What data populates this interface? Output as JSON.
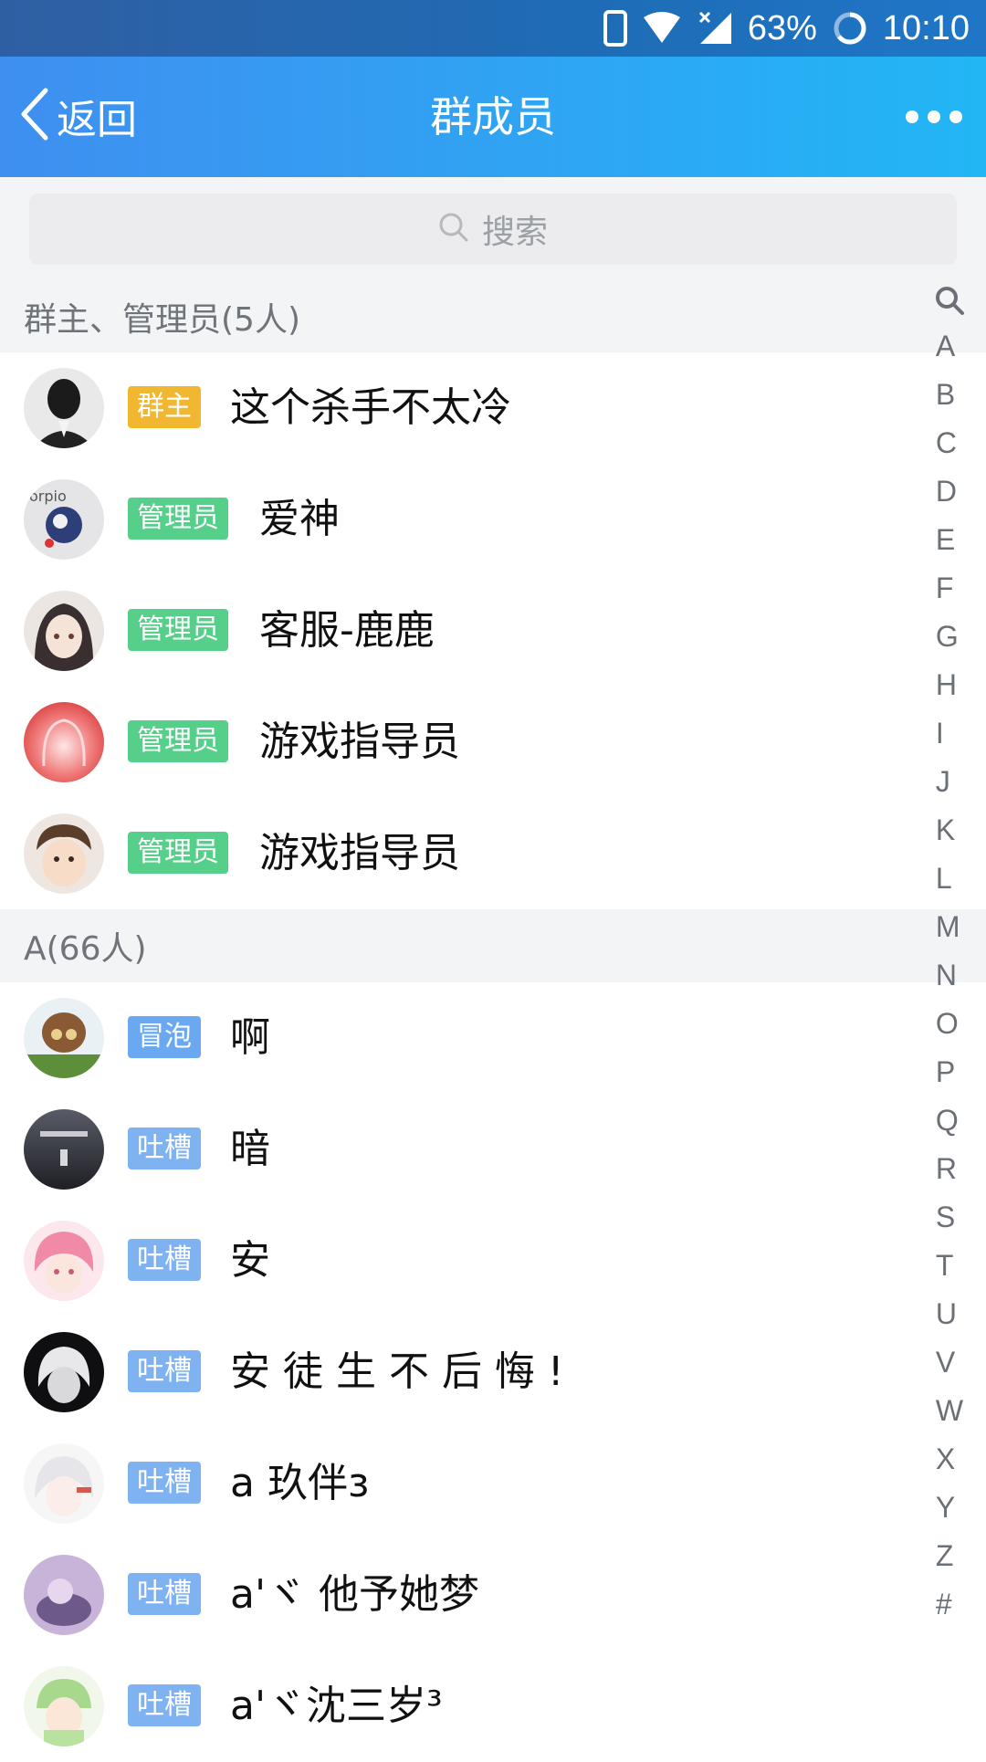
{
  "status_bar": {
    "battery": "63%",
    "time": "10:10"
  },
  "header": {
    "back_label": "返回",
    "title": "群成员"
  },
  "search": {
    "placeholder": "搜索"
  },
  "sections": [
    {
      "title": "群主、管理员(5人)"
    },
    {
      "title": "A(66人)"
    }
  ],
  "members": [
    {
      "tag": "群主",
      "name": "这个杀手不太冷"
    },
    {
      "tag": "管理员",
      "name": "爱神"
    },
    {
      "tag": "管理员",
      "name": "客服-鹿鹿"
    },
    {
      "tag": "管理员",
      "name": "游戏指导员"
    },
    {
      "tag": "管理员",
      "name": "游戏指导员"
    },
    {
      "tag": "冒泡",
      "name": "啊"
    },
    {
      "tag": "吐槽",
      "name": "暗"
    },
    {
      "tag": "吐槽",
      "name": "安"
    },
    {
      "tag": "吐槽",
      "name": "安 徒 生 不 后 悔 !"
    },
    {
      "tag": "吐槽",
      "name": "a  玖伴ɜ"
    },
    {
      "tag": "吐槽",
      "name": "a'ヾ 他予她梦"
    },
    {
      "tag": "吐槽",
      "name": "a'ヾ沈三岁³"
    }
  ],
  "index_letters": [
    "A",
    "B",
    "C",
    "D",
    "E",
    "F",
    "G",
    "H",
    "I",
    "J",
    "K",
    "L",
    "M",
    "N",
    "O",
    "P",
    "Q",
    "R",
    "S",
    "T",
    "U",
    "V",
    "W",
    "X",
    "Y",
    "Z",
    "#"
  ],
  "colors": {
    "header_start": "#3f8ff0",
    "header_end": "#22b6f5",
    "owner_tag": "#f2b731",
    "admin_tag": "#56cf8a",
    "tucao_tag": "#7fb2f0"
  }
}
